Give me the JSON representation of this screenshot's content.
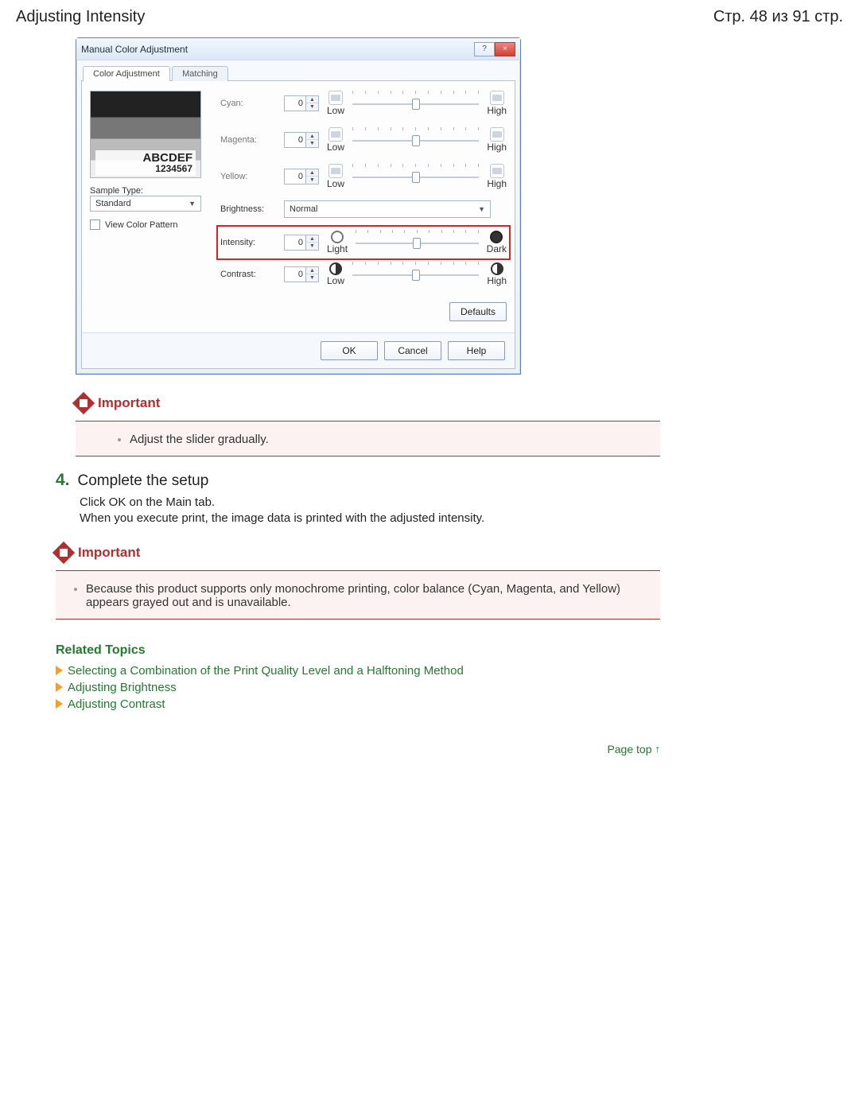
{
  "header": {
    "title": "Adjusting Intensity",
    "page_counter": "Стр. 48 из 91 стр."
  },
  "dialog": {
    "title": "Manual Color Adjustment",
    "help_btn": "?",
    "close_btn": "×",
    "tabs": {
      "active": "Color Adjustment",
      "inactive": "Matching"
    },
    "preview_text1": "ABCDEF",
    "preview_text2": "1234567",
    "sample_type_label": "Sample Type:",
    "sample_type_value": "Standard",
    "view_pattern": "View Color Pattern",
    "rows": {
      "cyan": {
        "label": "Cyan:",
        "value": "0",
        "low": "Low",
        "high": "High"
      },
      "magenta": {
        "label": "Magenta:",
        "value": "0",
        "low": "Low",
        "high": "High"
      },
      "yellow": {
        "label": "Yellow:",
        "value": "0",
        "low": "Low",
        "high": "High"
      },
      "brightness": {
        "label": "Brightness:",
        "value": "Normal"
      },
      "intensity": {
        "label": "Intensity:",
        "value": "0",
        "low": "Light",
        "high": "Dark"
      },
      "contrast": {
        "label": "Contrast:",
        "value": "0",
        "low": "Low",
        "high": "High"
      }
    },
    "defaults_btn": "Defaults",
    "ok_btn": "OK",
    "cancel_btn": "Cancel",
    "help2_btn": "Help"
  },
  "important1": {
    "heading": "Important",
    "item": "Adjust the slider gradually."
  },
  "step": {
    "num": "4.",
    "title": "Complete the setup",
    "line1": "Click OK on the Main tab.",
    "line2": "When you execute print, the image data is printed with the adjusted intensity."
  },
  "important2": {
    "heading": "Important",
    "item": "Because this product supports only monochrome printing, color balance (Cyan, Magenta, and Yellow) appears grayed out and is unavailable."
  },
  "related": {
    "heading": "Related Topics",
    "links": [
      "Selecting a Combination of the Print Quality Level and a Halftoning Method",
      "Adjusting Brightness",
      "Adjusting Contrast"
    ]
  },
  "pagetop": "Page top"
}
